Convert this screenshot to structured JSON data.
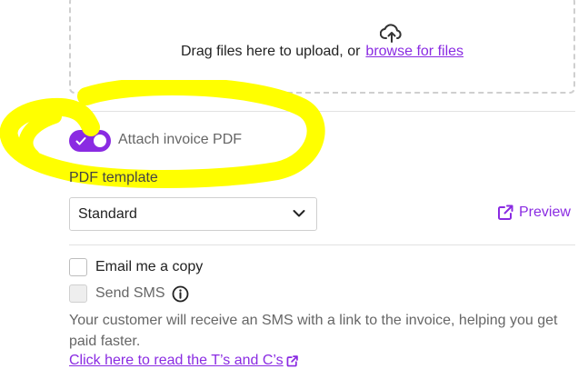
{
  "upload": {
    "drag_text": "Drag files here to upload, or",
    "browse_link": "browse for files",
    "icon": "cloud-upload-icon"
  },
  "attach_pdf": {
    "label": "Attach invoice PDF",
    "enabled": true
  },
  "pdf_template": {
    "label": "PDF template",
    "selected": "Standard",
    "preview_label": "Preview",
    "preview_icon": "external-link-icon"
  },
  "options": {
    "email_copy_label": "Email me a copy",
    "email_copy_checked": false,
    "send_sms_label": "Send SMS",
    "send_sms_checked": false,
    "send_sms_disabled": true,
    "info_icon": "info-icon"
  },
  "helper_text": "Your customer will receive an SMS with a link to the invoice, helping you get paid faster.",
  "terms_link": "Click here to read the T’s and C’s",
  "colors": {
    "accent": "#8a2be2",
    "highlight": "#ffff00",
    "muted_text": "#666666"
  }
}
